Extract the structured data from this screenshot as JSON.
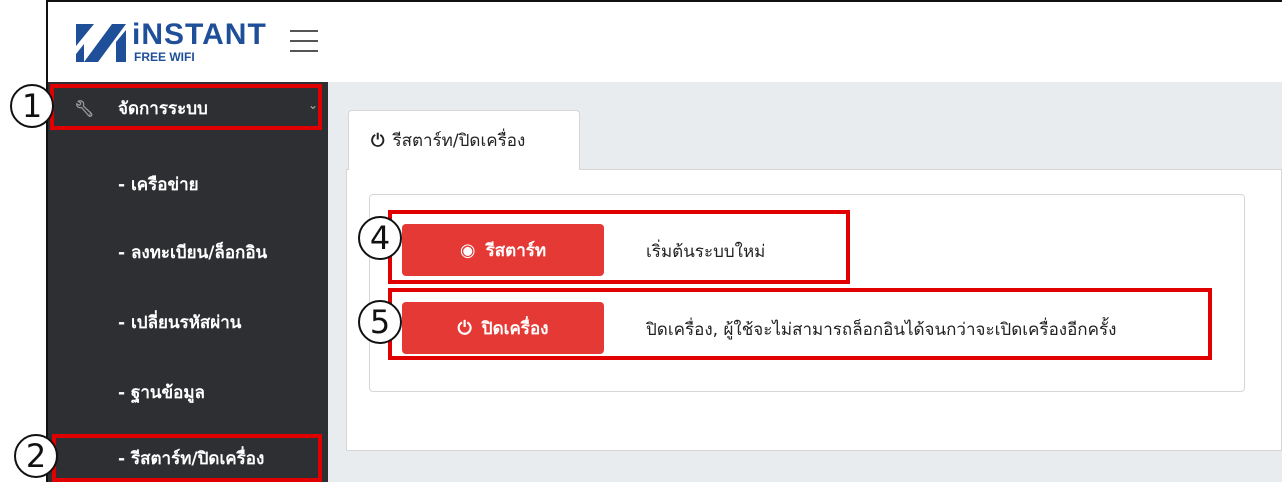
{
  "brand": {
    "title": "iNSTANT",
    "subtitle": "FREE WIFI"
  },
  "sidebar": {
    "section": {
      "label": "จัดการระบบ",
      "icon": "wrench-icon",
      "chevron": "chevron-down-icon"
    },
    "items": [
      {
        "label": "- เครือข่าย"
      },
      {
        "label": "- ลงทะเบียน/ล็อกอิน"
      },
      {
        "label": "- เปลี่ยนรหัสผ่าน"
      },
      {
        "label": "- ฐานข้อมูล"
      },
      {
        "label": "- รีสตาร์ท/ปิดเครื่อง"
      }
    ]
  },
  "tab": {
    "label": "รีสตาร์ท/ปิดเครื่อง",
    "icon": "power-icon"
  },
  "actions": {
    "restart": {
      "label": "รีสตาร์ท",
      "icon": "target-icon",
      "description": "เริ่มต้นระบบใหม่"
    },
    "shutdown": {
      "label": "ปิดเครื่อง",
      "icon": "power-icon",
      "description": "ปิดเครื่อง, ผู้ใช้จะไม่สามารถล็อกอินได้จนกว่าจะเปิดเครื่องอีกครั้ง"
    }
  },
  "annotations": {
    "n1": "1",
    "n2": "2",
    "n4": "4",
    "n5": "5"
  },
  "colors": {
    "brand": "#1f4f98",
    "sidebar": "#2d2f33",
    "button": "#e53935",
    "highlight": "#e00000"
  }
}
